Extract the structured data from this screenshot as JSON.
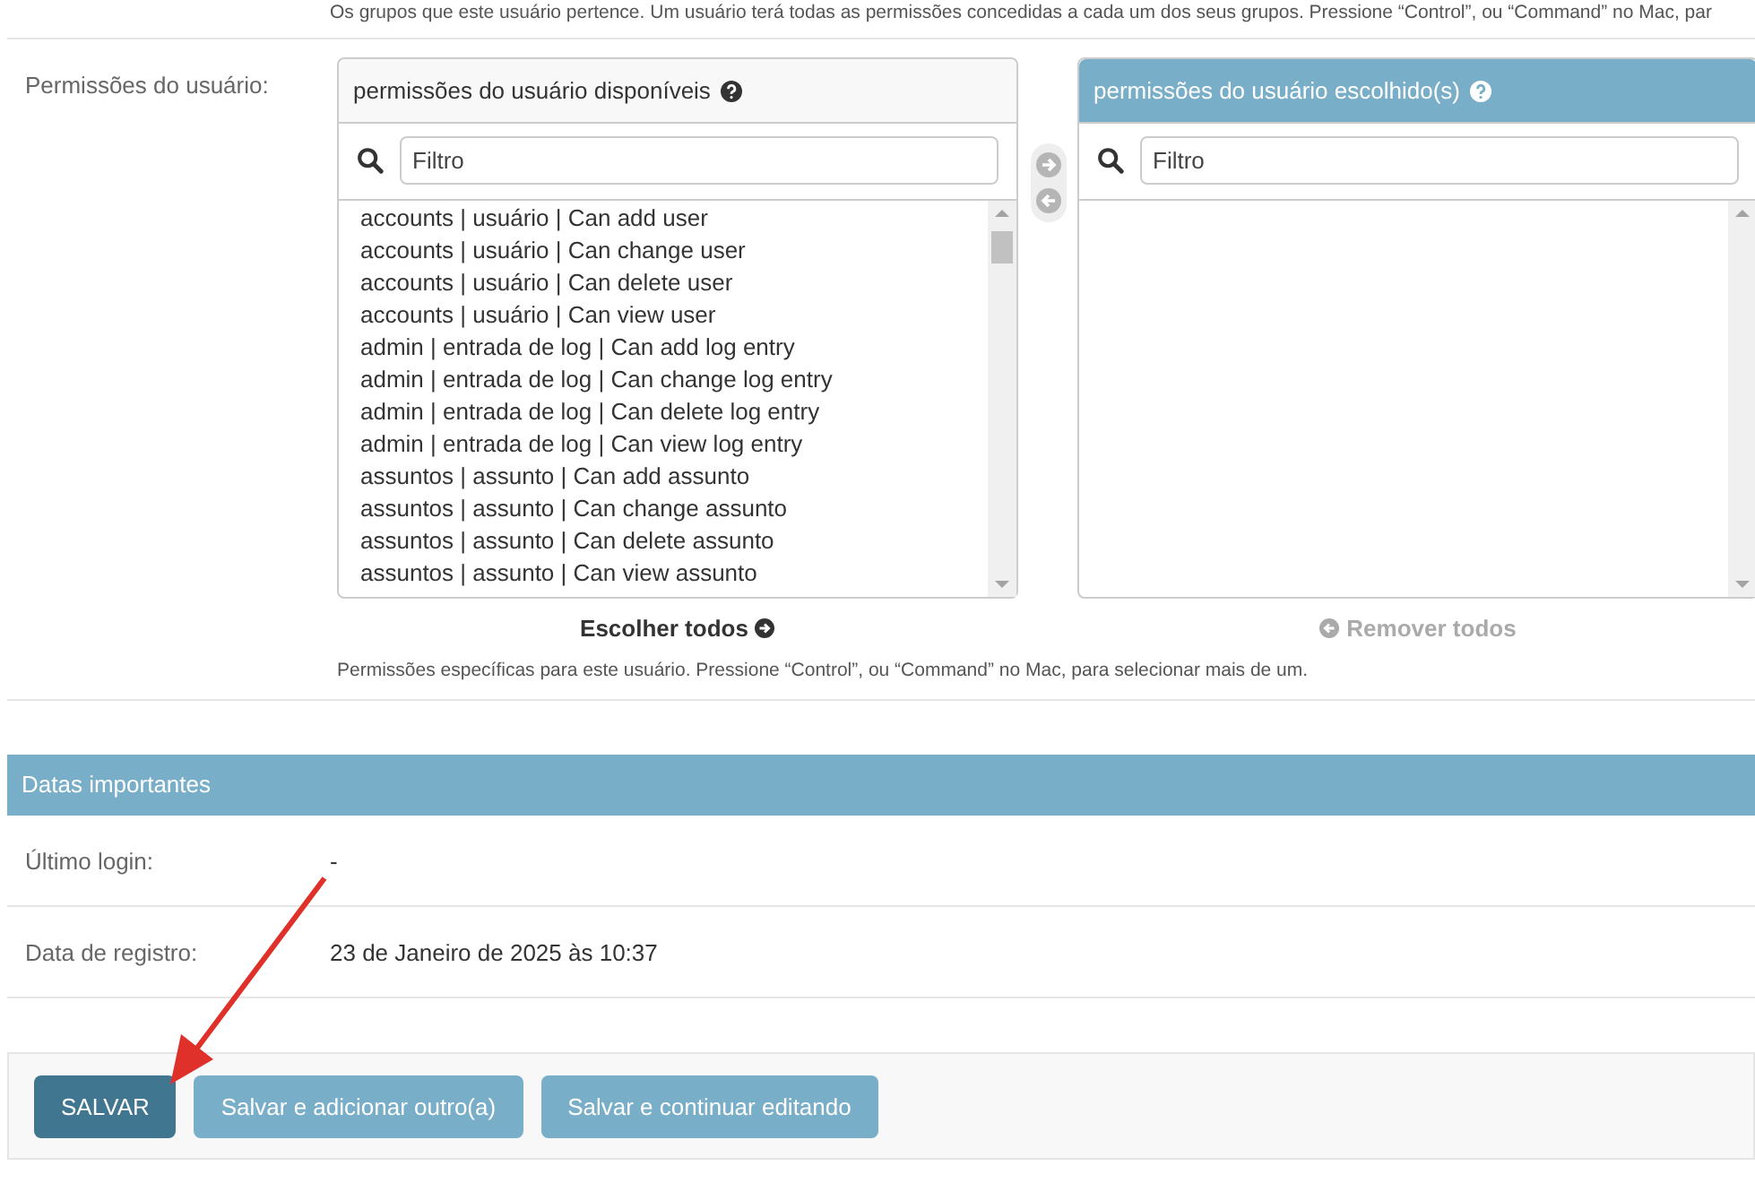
{
  "groups_help": "Os grupos que este usuário pertence. Um usuário terá todas as permissões concedidas a cada um dos seus grupos. Pressione “Control”, ou “Command” no Mac, par",
  "permissions": {
    "label": "Permissões do usuário:",
    "available": {
      "title": "permissões do usuário disponíveis",
      "filter": {
        "placeholder": "Filtro"
      },
      "options": [
        "accounts | usuário | Can add user",
        "accounts | usuário | Can change user",
        "accounts | usuário | Can delete user",
        "accounts | usuário | Can view user",
        "admin | entrada de log | Can add log entry",
        "admin | entrada de log | Can change log entry",
        "admin | entrada de log | Can delete log entry",
        "admin | entrada de log | Can view log entry",
        "assuntos | assunto | Can add assunto",
        "assuntos | assunto | Can change assunto",
        "assuntos | assunto | Can delete assunto",
        "assuntos | assunto | Can view assunto"
      ]
    },
    "chosen": {
      "title": "permissões do usuário escolhido(s)",
      "filter": {
        "placeholder": "Filtro"
      }
    },
    "move_buttons": [
      {
        "kind": "add",
        "disabled": true
      },
      {
        "kind": "remove",
        "disabled": true
      }
    ],
    "choose_all": {
      "label": "Escolher todos",
      "disabled": false
    },
    "remove_all": {
      "label": "Remover todos",
      "disabled": true
    },
    "help": "Permissões específicas para este usuário. Pressione “Control”, ou “Command” no Mac, para selecionar mais de um."
  },
  "important_dates": {
    "title": "Datas importantes",
    "rows": [
      {
        "label": "Último login:",
        "value": "-"
      },
      {
        "label": "Data de registro:",
        "value": "23 de Janeiro de 2025 às 10:37"
      }
    ]
  },
  "submit_row": {
    "buttons": [
      {
        "label": "SALVAR",
        "kind": "primary"
      },
      {
        "label": "Salvar e adicionar outro(a)",
        "kind": "secondary"
      },
      {
        "label": "Salvar e continuar editando",
        "kind": "secondary"
      }
    ]
  }
}
